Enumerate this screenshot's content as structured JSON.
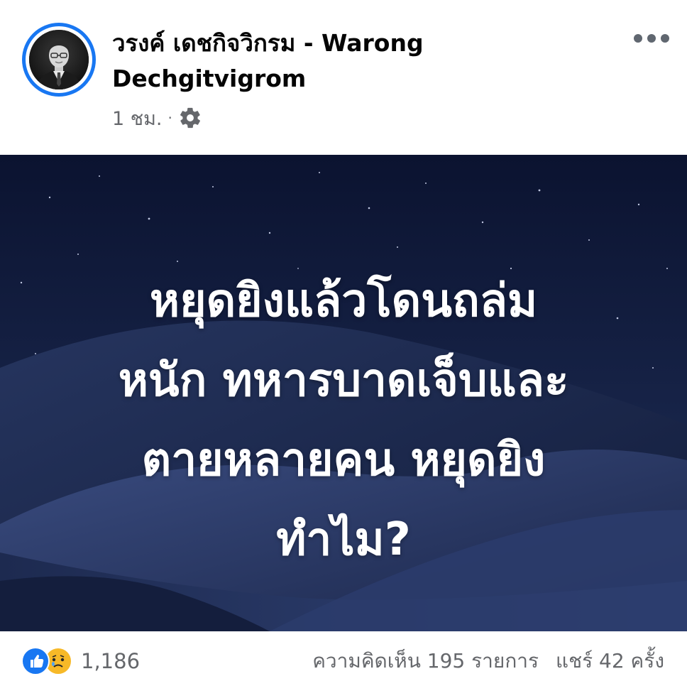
{
  "post": {
    "author": {
      "name": "วรงค์ เดชกิจวิกรม - Warong Dechgitvigrom"
    },
    "timestamp": "1 ชม.",
    "separator": "·",
    "privacy_icon": "settings-gear-icon",
    "more_icon": "more-options-icon",
    "image": {
      "text": "หยุดยิงแล้วโดนถล่ม\nหนัก ทหารบาดเจ็บและ\nตายหลายคน หยุดยิง\nทำไม?"
    },
    "reactions": {
      "icons": [
        "like-icon",
        "sad-icon"
      ],
      "count": "1,186"
    },
    "comments_label": "ความคิดเห็น 195 รายการ",
    "shares_label": "แชร์ 42 ครั้ง"
  },
  "colors": {
    "accent": "#1877f2",
    "secondary_text": "#65676b",
    "sad_reaction": "#f7b928",
    "image_background": "#0f1a36"
  }
}
